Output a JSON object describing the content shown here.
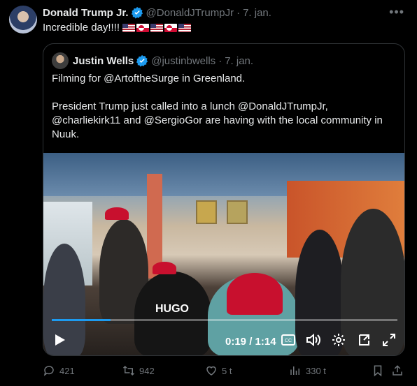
{
  "author": {
    "name": "Donald Trump Jr.",
    "handle": "@DonaldJTrumpJr",
    "date": "7. jan."
  },
  "tweet": {
    "text": "Incredible day!!!!",
    "flags": [
      "us-flag",
      "greenland-flag",
      "us-flag",
      "greenland-flag",
      "us-flag"
    ]
  },
  "quote": {
    "author": {
      "name": "Justin Wells",
      "handle": "@justinbwells",
      "date": "7. jan."
    },
    "paragraph1": "Filming for @ArtoftheSurge in Greenland.",
    "paragraph2": "President Trump just called into a lunch @DonaldJTrumpJr, @charliekirk11 and @SergioGor are having with the local community in Nuuk.",
    "video": {
      "time": "0:19 / 1:14",
      "progress": 0.17,
      "shirt_text": "HUGO"
    }
  },
  "actions": {
    "replies": "421",
    "reposts": "942",
    "likes": "5 t",
    "views": "330 t"
  },
  "colors": {
    "accent": "#1d9bf0",
    "muted": "#71767b",
    "text": "#e7e9ea",
    "background": "#000000",
    "border": "#2f3336"
  }
}
